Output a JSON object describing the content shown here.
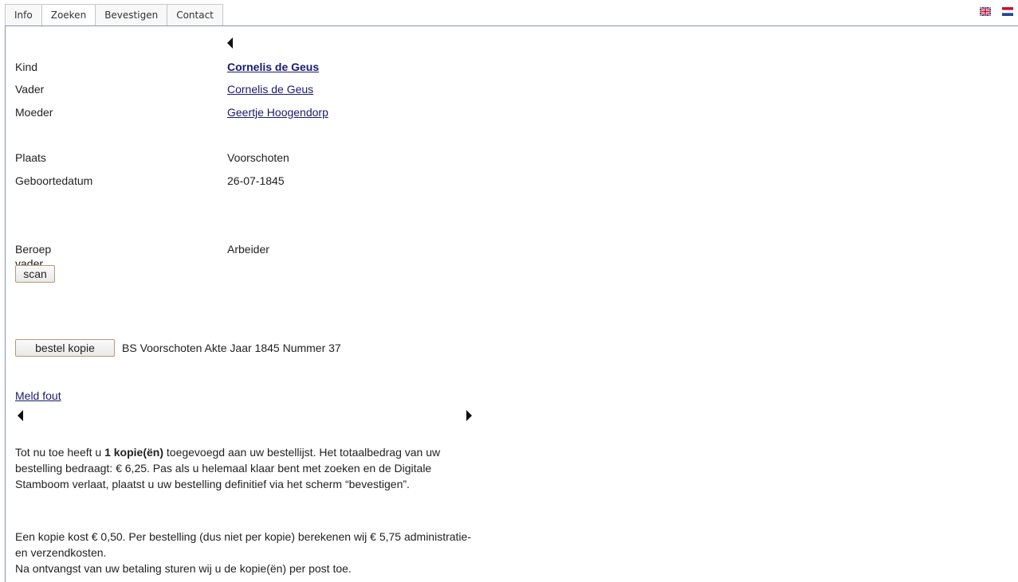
{
  "tabs": [
    {
      "label": "Info"
    },
    {
      "label": "Zoeken"
    },
    {
      "label": "Bevestigen"
    },
    {
      "label": "Contact"
    }
  ],
  "flags": {
    "english": "uk-flag-icon",
    "dutch": "nl-flag-icon"
  },
  "record": {
    "kind_label": "Kind",
    "kind_value": "Cornelis de Geus",
    "vader_label": "Vader",
    "vader_value": "Cornelis de Geus",
    "moeder_label": "Moeder",
    "moeder_value": "Geertje Hoogendorp",
    "plaats_label": "Plaats",
    "plaats_value": "Voorschoten",
    "geboortedatum_label": "Geboortedatum",
    "geboortedatum_value": "26-07-1845",
    "beroep_label": "Beroep vader",
    "beroep_value": "Arbeider"
  },
  "buttons": {
    "scan": "scan",
    "bestel": "bestel kopie"
  },
  "akte_text": "BS Voorschoten Akte Jaar 1845 Nummer 37",
  "meld_fout": "Meld fout",
  "order_info": {
    "p1_a": "Tot nu toe heeft u ",
    "p1_bold": "1 kopie(ën)",
    "p1_b": " toegevoegd aan uw bestellijst. Het totaalbedrag van uw bestelling bedraagt: € 6,25. Pas als u helemaal klaar bent met zoeken en de Digitale Stamboom verlaat, plaatst u uw bestelling definitief via het scherm “bevestigen”.",
    "p2": "Een kopie kost € 0,50. Per bestelling (dus niet per kopie) berekenen wij € 5,75 administratie- en verzendkosten.",
    "p3": "Na ontvangst van uw betaling sturen wij u de kopie(ën) per post toe."
  }
}
